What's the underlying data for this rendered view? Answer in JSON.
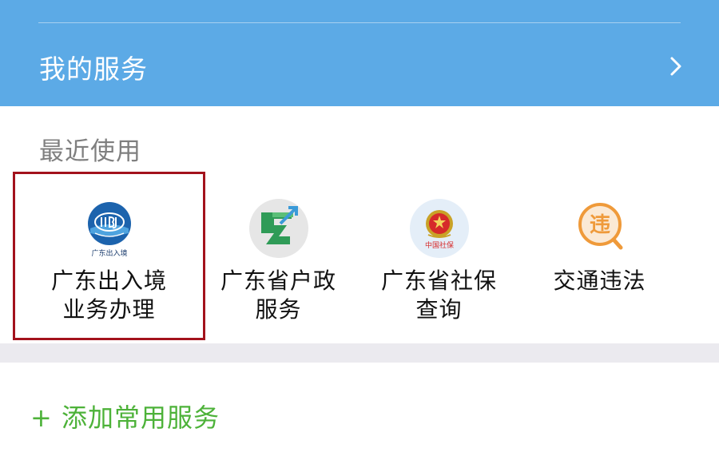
{
  "header": {
    "my_services_label": "我的服务",
    "chevron_icon": "chevron-right-icon",
    "background_color": "#5caae6"
  },
  "recent": {
    "label": "最近使用",
    "services": [
      {
        "icon": "guangdong-exit-entry-icon",
        "icon_text": "广东出入境",
        "name_line1": "广东出入境",
        "name_line2": "业务办理",
        "highlighted": true
      },
      {
        "icon": "guangdong-household-registry-icon",
        "name_line1": "广东省户政",
        "name_line2": "服务",
        "highlighted": false
      },
      {
        "icon": "guangdong-social-security-icon",
        "icon_text": "中国社保",
        "name_line1": "广东省社保",
        "name_line2": "查询",
        "highlighted": false
      },
      {
        "icon": "traffic-violation-icon",
        "icon_text": "违",
        "name_line1": "交通违法",
        "name_line2": "",
        "highlighted": false
      }
    ]
  },
  "footer": {
    "add_label": "+ 添加常用服务",
    "add_color": "#4db239"
  },
  "colors": {
    "highlight_border": "#a3121c",
    "separator": "#ebeaef"
  }
}
